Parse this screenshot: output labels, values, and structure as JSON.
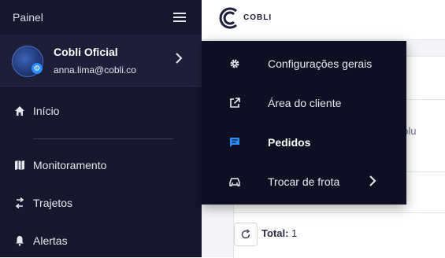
{
  "sidebar": {
    "title": "Painel",
    "profile": {
      "name": "Cobli Oficial",
      "email": "anna.lima@cobli.co"
    },
    "items": [
      {
        "label": "Início",
        "icon": "home-icon"
      },
      {
        "label": "Monitoramento",
        "icon": "map-icon"
      },
      {
        "label": "Trajetos",
        "icon": "route-icon"
      },
      {
        "label": "Alertas",
        "icon": "bell-icon"
      }
    ]
  },
  "topbar": {
    "brand": "COBLI"
  },
  "main": {
    "tab_partial": "Devolu",
    "total_label": "Total:",
    "total_value": "1"
  },
  "menu": {
    "items": [
      {
        "label": "Configurações gerais",
        "icon": "gear-icon"
      },
      {
        "label": "Área do cliente",
        "icon": "external-link-icon"
      },
      {
        "label": "Pedidos",
        "icon": "chat-icon",
        "active": true
      },
      {
        "label": "Trocar de frota",
        "icon": "car-icon",
        "has_submenu": true
      }
    ]
  },
  "colors": {
    "sidebar_bg": "#16172d",
    "profile_bg": "#1d1f38",
    "menu_bg": "#0e0f22",
    "accent_blue": "#2a8cff"
  }
}
